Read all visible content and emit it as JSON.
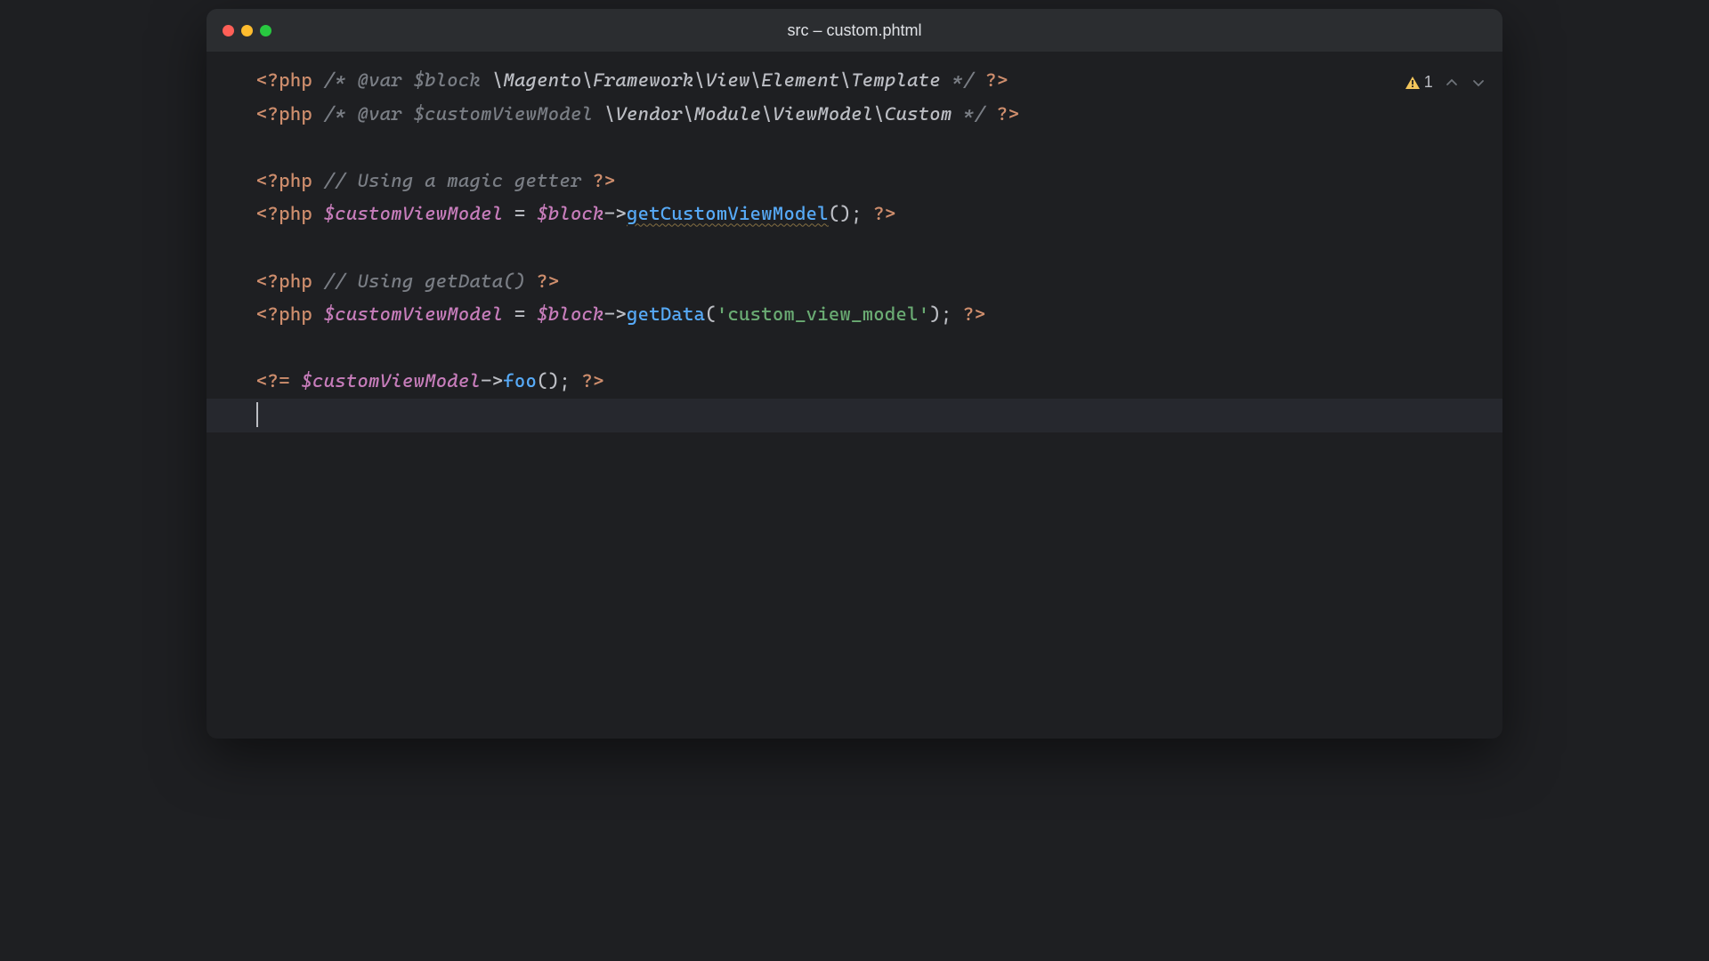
{
  "window": {
    "title": "src – custom.phtml"
  },
  "inspection": {
    "warning_count": "1"
  },
  "code": {
    "l1": {
      "open": "<?php",
      "cmt_open": "/* ",
      "tag": "@var",
      "var": " $block",
      "ns": " \\Magento\\Framework\\View\\Element\\Template ",
      "cmt_close": "*/",
      "close": " ?>"
    },
    "l2": {
      "open": "<?php",
      "cmt_open": "/* ",
      "tag": "@var",
      "var": " $customViewModel",
      "ns": " \\Vendor\\Module\\ViewModel\\Custom ",
      "cmt_close": "*/",
      "close": " ?>"
    },
    "l4": {
      "open": "<?php",
      "comment": " // Using a magic getter ",
      "close": "?>"
    },
    "l5": {
      "open": "<?php",
      "var1": " $customViewModel",
      "eq": " = ",
      "var2": "$block",
      "arrow": "->",
      "method": "getCustomViewModel",
      "parens": "(); ",
      "close": "?>"
    },
    "l7": {
      "open": "<?php",
      "comment": " // Using getData() ",
      "close": "?>"
    },
    "l8": {
      "open": "<?php",
      "var1": " $customViewModel",
      "eq": " = ",
      "var2": "$block",
      "arrow": "->",
      "method": "getData",
      "paren_open": "(",
      "str": "'custom_view_model'",
      "paren_close": "); ",
      "close": "?>"
    },
    "l10": {
      "open": "<?=",
      "var": " $customViewModel",
      "arrow": "->",
      "method": "foo",
      "parens": "(); ",
      "close": "?>"
    }
  }
}
